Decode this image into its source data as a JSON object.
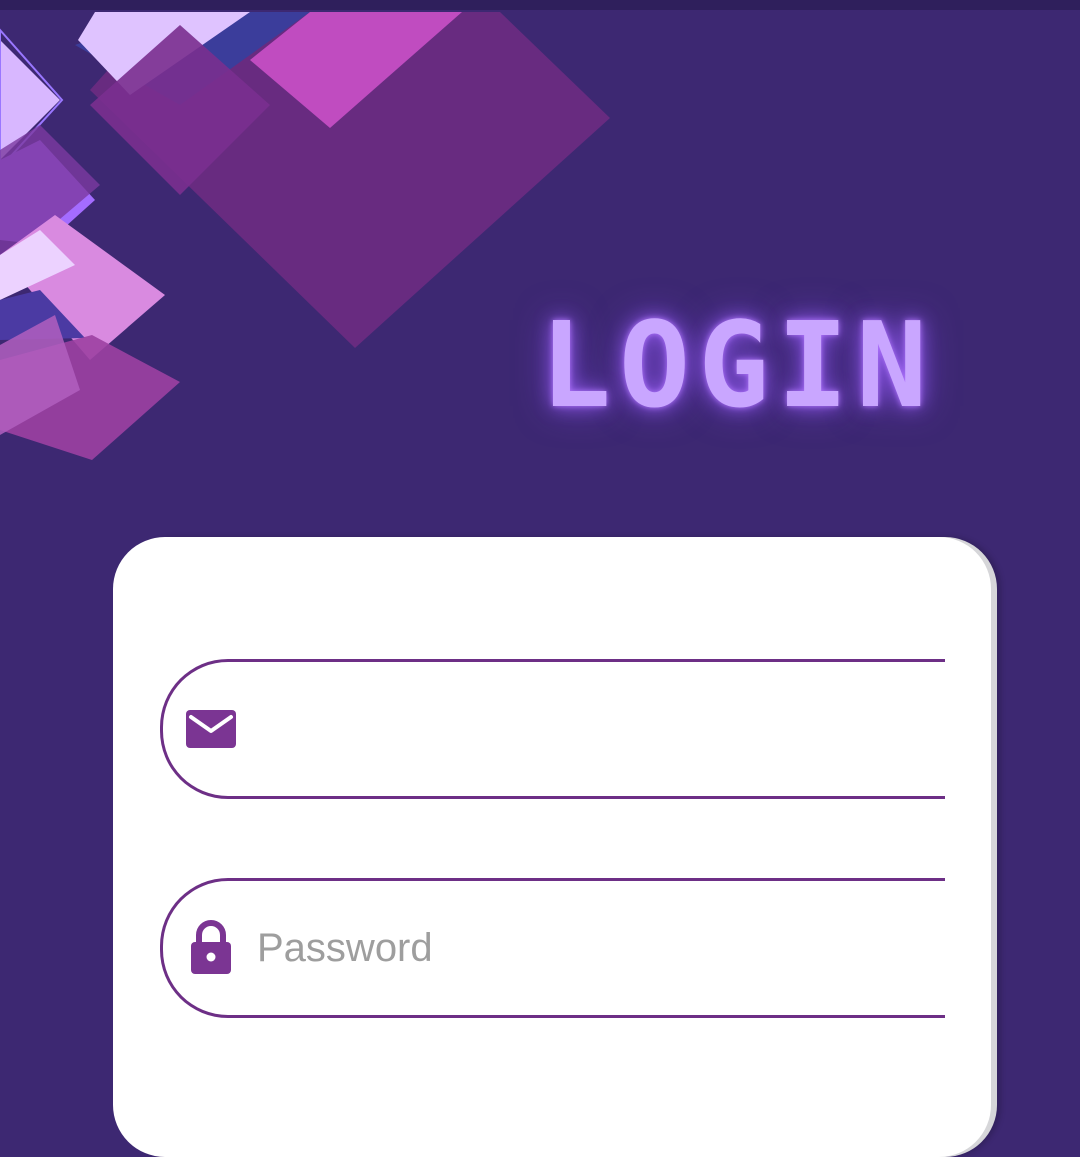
{
  "screen": {
    "title": "LOGIN"
  },
  "form": {
    "email": {
      "icon": "envelope-icon",
      "value": "",
      "placeholder": ""
    },
    "password": {
      "icon": "lock-icon",
      "value": "",
      "placeholder": "Password"
    }
  },
  "colors": {
    "background": "#3d2872",
    "title_glow": "#c9a6ff",
    "field_border": "#6d2f86",
    "icon": "#7b3593",
    "card": "#ffffff"
  }
}
